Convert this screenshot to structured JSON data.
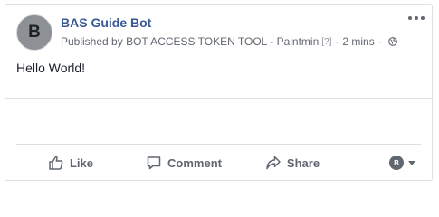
{
  "post": {
    "page_name": "BAS Guide Bot",
    "avatar_letter": "B",
    "byline_prefix": "Published by",
    "app_name": "BOT ACCESS TOKEN TOOL - Paintmin",
    "help_marker": "[?]",
    "separator": "·",
    "time": "2 mins",
    "privacy_icon": "globe-icon",
    "text": "Hello World!"
  },
  "actions": {
    "like_label": "Like",
    "comment_label": "Comment",
    "share_label": "Share",
    "audience_avatar_letter": "B"
  },
  "colors": {
    "page_name": "#385898",
    "meta_text": "#616770",
    "body_text": "#1d2129",
    "border": "#dddfe2"
  }
}
